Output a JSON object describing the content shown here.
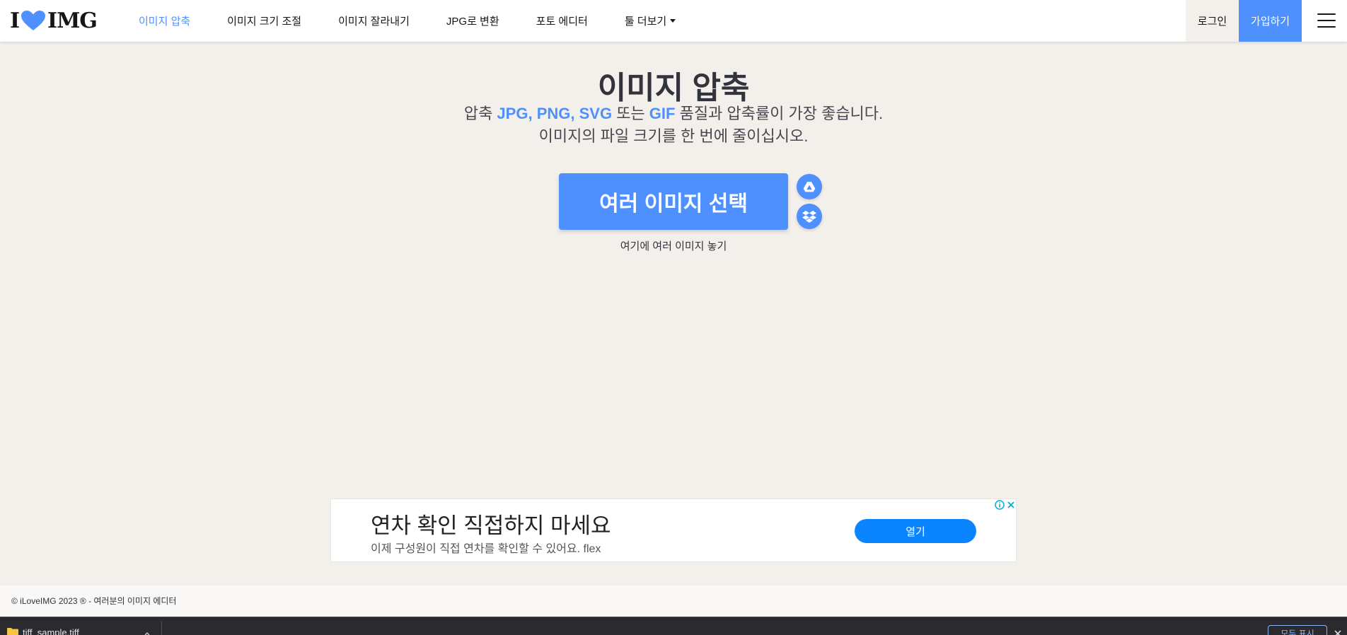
{
  "header": {
    "logo": {
      "left": "I",
      "right": "IMG",
      "heart_color": "#4d90fe"
    },
    "nav": [
      {
        "label": "이미지 압축",
        "active": true
      },
      {
        "label": "이미지 크기 조절",
        "active": false
      },
      {
        "label": "이미지 잘라내기",
        "active": false
      },
      {
        "label": "JPG로 변환",
        "active": false
      },
      {
        "label": "포토 에디터",
        "active": false
      },
      {
        "label": "툴 더보기",
        "active": false,
        "dropdown": true
      }
    ],
    "login_label": "로그인",
    "signup_label": "가입하기"
  },
  "main": {
    "title": "이미지 압축",
    "subtitle": {
      "prefix": "압축 ",
      "fmt1": "JPG",
      "sep1": ", ",
      "fmt2": "PNG",
      "sep2": ", ",
      "fmt3": "SVG",
      "mid": " 또는 ",
      "fmt4": "GIF",
      "suffix": " 품질과 압축률이 가장 좋습니다.",
      "line2": "이미지의 파일 크기를 한 번에 줄이십시오."
    },
    "select_button_label": "여러 이미지 선택",
    "drop_hint": "여기에 여러 이미지 놓기"
  },
  "ad": {
    "headline": "연차 확인 직접하지 마세요",
    "description": "이제 구성원이 직접 연차를 확인할 수 있어요. flex",
    "open_label": "열기"
  },
  "footer": {
    "text": "© iLoveIMG 2023 ® - 여러분의 이미지 에디터"
  },
  "download_bar": {
    "file_name": "tiff_sample.tiff",
    "show_all_label": "모두 표시"
  },
  "colors": {
    "accent": "#4d90fe",
    "page_bg": "#f3f0ec",
    "text": "#33333b"
  }
}
